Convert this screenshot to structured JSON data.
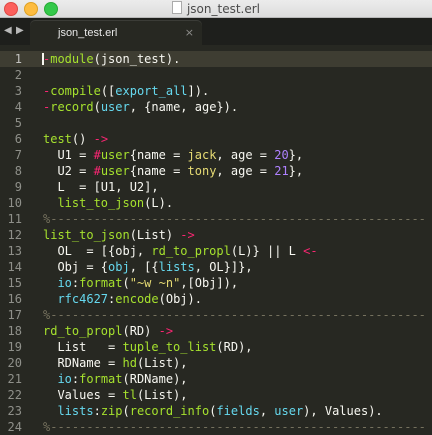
{
  "window": {
    "title": "json_test.erl"
  },
  "tab": {
    "label": "json_test.erl",
    "close": "×"
  },
  "nav": {
    "back": "◀",
    "forward": "▶"
  },
  "editor": {
    "current_line": 1,
    "lines": [
      {
        "n": "1",
        "segs": [
          [
            "kw",
            "-"
          ],
          [
            "fn",
            "module"
          ],
          [
            "",
            "(json_test)."
          ]
        ]
      },
      {
        "n": "2",
        "segs": []
      },
      {
        "n": "3",
        "segs": [
          [
            "kw",
            "-"
          ],
          [
            "fn",
            "compile"
          ],
          [
            "",
            "(["
          ],
          [
            "cn",
            "export_all"
          ],
          [
            "",
            "])."
          ]
        ]
      },
      {
        "n": "4",
        "segs": [
          [
            "kw",
            "-"
          ],
          [
            "fn",
            "record"
          ],
          [
            "",
            "("
          ],
          [
            "cn",
            "user"
          ],
          [
            "",
            ", {name, age})."
          ]
        ]
      },
      {
        "n": "5",
        "segs": []
      },
      {
        "n": "6",
        "segs": [
          [
            "fn",
            "test"
          ],
          [
            "",
            "() "
          ],
          [
            "kw",
            "->"
          ]
        ]
      },
      {
        "n": "7",
        "segs": [
          [
            "",
            "  U1 = "
          ],
          [
            "kw",
            "#"
          ],
          [
            "fn",
            "user"
          ],
          [
            "",
            "{name = "
          ],
          [
            "st",
            "jack"
          ],
          [
            "",
            ", age = "
          ],
          [
            "nu",
            "20"
          ],
          [
            "",
            "},"
          ]
        ]
      },
      {
        "n": "8",
        "segs": [
          [
            "",
            "  U2 = "
          ],
          [
            "kw",
            "#"
          ],
          [
            "fn",
            "user"
          ],
          [
            "",
            "{name = "
          ],
          [
            "st",
            "tony"
          ],
          [
            "",
            ", age = "
          ],
          [
            "nu",
            "21"
          ],
          [
            "",
            "},"
          ]
        ]
      },
      {
        "n": "9",
        "segs": [
          [
            "",
            "  L  = [U1, U2],"
          ]
        ]
      },
      {
        "n": "10",
        "segs": [
          [
            "",
            "  "
          ],
          [
            "fn",
            "list_to_json"
          ],
          [
            "",
            "(L)."
          ]
        ]
      },
      {
        "n": "11",
        "segs": [
          [
            "cm",
            "%----------------------------------------------------"
          ]
        ]
      },
      {
        "n": "12",
        "segs": [
          [
            "fn",
            "list_to_json"
          ],
          [
            "",
            "(List) "
          ],
          [
            "kw",
            "->"
          ]
        ]
      },
      {
        "n": "13",
        "segs": [
          [
            "",
            "  OL  = [{obj, "
          ],
          [
            "fn",
            "rd_to_propl"
          ],
          [
            "",
            "(L)} || L "
          ],
          [
            "kw",
            "<-"
          ],
          [
            "",
            "",
            " List],"
          ]
        ]
      },
      {
        "n": "14",
        "segs": [
          [
            "",
            "  Obj = {"
          ],
          [
            "cn",
            "obj"
          ],
          [
            "",
            ", [{"
          ],
          [
            "cn",
            "lists"
          ],
          [
            "",
            ", OL}]},"
          ]
        ]
      },
      {
        "n": "15",
        "segs": [
          [
            "",
            "  "
          ],
          [
            "cn",
            "io"
          ],
          [
            "",
            ":"
          ],
          [
            "fn",
            "format"
          ],
          [
            "",
            "("
          ],
          [
            "st",
            "\"~w ~n\""
          ],
          [
            "",
            ",[Obj]),"
          ]
        ]
      },
      {
        "n": "16",
        "segs": [
          [
            "",
            "  "
          ],
          [
            "cn",
            "rfc4627"
          ],
          [
            "",
            ":"
          ],
          [
            "fn",
            "encode"
          ],
          [
            "",
            "(Obj)."
          ]
        ]
      },
      {
        "n": "17",
        "segs": [
          [
            "cm",
            "%----------------------------------------------------"
          ]
        ]
      },
      {
        "n": "18",
        "segs": [
          [
            "fn",
            "rd_to_propl"
          ],
          [
            "",
            "(RD) "
          ],
          [
            "kw",
            "->"
          ]
        ]
      },
      {
        "n": "19",
        "segs": [
          [
            "",
            "  List   = "
          ],
          [
            "fn",
            "tuple_to_list"
          ],
          [
            "",
            "(RD),"
          ]
        ]
      },
      {
        "n": "20",
        "segs": [
          [
            "",
            "  RDName = "
          ],
          [
            "fn",
            "hd"
          ],
          [
            "",
            "(List),"
          ]
        ]
      },
      {
        "n": "21",
        "segs": [
          [
            "",
            "  "
          ],
          [
            "cn",
            "io"
          ],
          [
            "",
            ":"
          ],
          [
            "fn",
            "format"
          ],
          [
            "",
            "(RDName),"
          ]
        ]
      },
      {
        "n": "22",
        "segs": [
          [
            "",
            "  Values = "
          ],
          [
            "fn",
            "tl"
          ],
          [
            "",
            "(List),"
          ]
        ]
      },
      {
        "n": "23",
        "segs": [
          [
            "",
            "  "
          ],
          [
            "cn",
            "lists"
          ],
          [
            "",
            ":"
          ],
          [
            "fn",
            "zip"
          ],
          [
            "",
            "("
          ],
          [
            "fn",
            "record_info"
          ],
          [
            "",
            "("
          ],
          [
            "cn",
            "fields"
          ],
          [
            "",
            ", "
          ],
          [
            "cn",
            "user"
          ],
          [
            "",
            "), Values)."
          ]
        ]
      },
      {
        "n": "24",
        "segs": [
          [
            "cm",
            "%----------------------------------------------------"
          ]
        ]
      }
    ]
  }
}
